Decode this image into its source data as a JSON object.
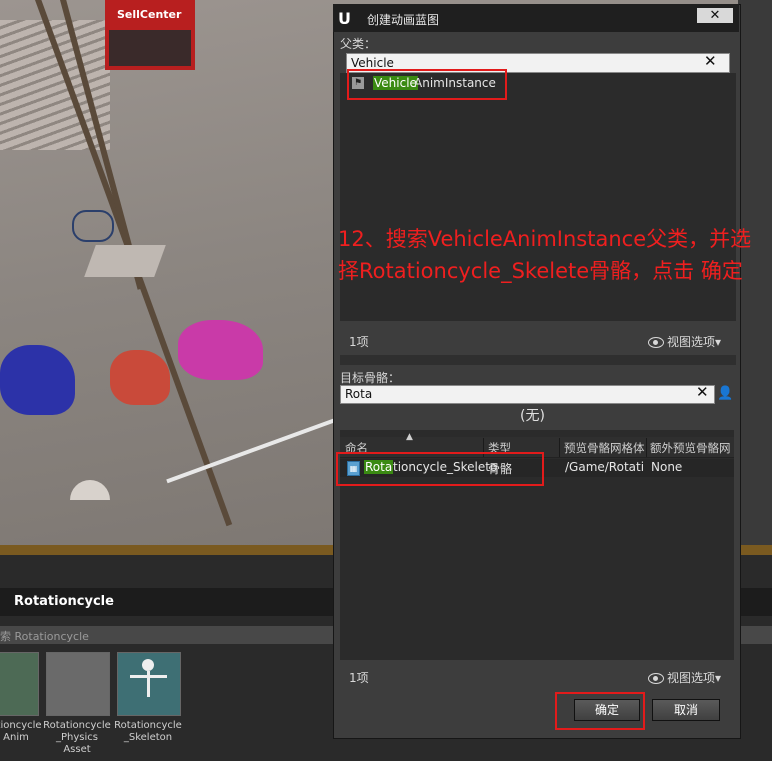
{
  "dialog": {
    "title": "创建动画蓝图",
    "close_glyph": "✕",
    "parent_class": {
      "label": "父类：",
      "search_value": "Vehicle",
      "clear_glyph": "✕",
      "results": [
        {
          "highlight": "Vehicle",
          "rest": "AnimInstance",
          "icon": "actor-class-icon"
        }
      ],
      "count": "1项",
      "view_options": "视图选项▾"
    },
    "target_skeleton": {
      "label": "目标骨骼：",
      "search_value": "Rota",
      "clear_glyph": "✕",
      "selected_text": "(无)",
      "columns": [
        "命名",
        "类型",
        "预览骨骼网格体",
        "额外预览骨骼网"
      ],
      "rows": [
        {
          "highlight": "Rota",
          "rest": "tioncycle_Skeleto",
          "type": "骨骼",
          "path": "/Game/Rotatio",
          "extra": "None"
        }
      ],
      "count": "1项",
      "view_options": "视图选项▾"
    },
    "buttons": {
      "ok": "确定",
      "cancel": "取消"
    }
  },
  "annotation": {
    "text": "12、搜索VehicleAnimInstance父类，并选择Rotationcycle_Skelete骨骼，点击 确定",
    "color": "#ef1f1f"
  },
  "content_browser": {
    "path": "Rotationcycle",
    "filter_text": "索 Rotationcycle",
    "assets": [
      {
        "label": "ationcycle\nAnim"
      },
      {
        "label": "Rotationcycle\n_Physics\nAsset"
      },
      {
        "label": "Rotationcycle\n_Skeleton"
      }
    ]
  },
  "viewport": {
    "sign_text": "SellCenter"
  },
  "colors": {
    "highlight_green": "#3a8a12",
    "callout_red": "#e21b1b",
    "panel_bg": "#3d3d3d"
  }
}
